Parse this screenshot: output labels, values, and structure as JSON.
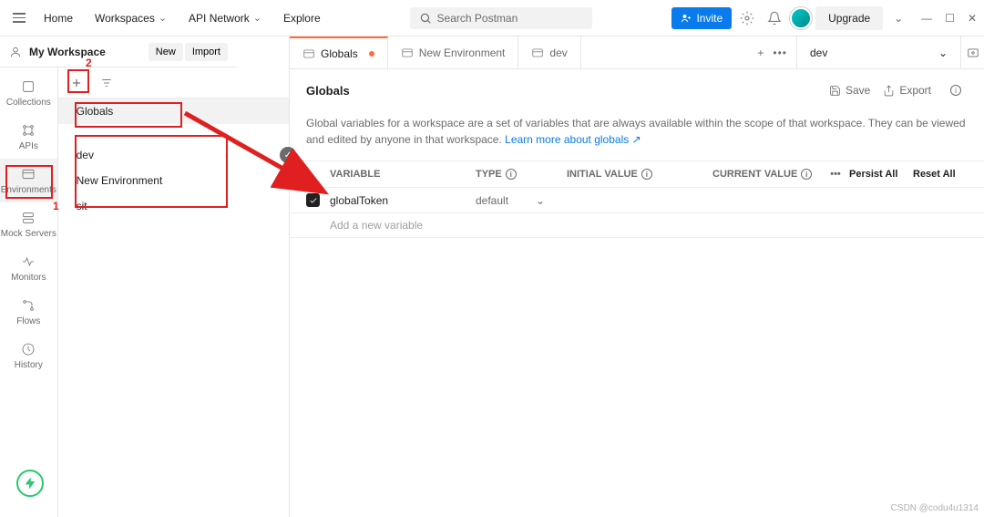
{
  "topnav": {
    "home": "Home",
    "workspaces": "Workspaces",
    "api_network": "API Network",
    "explore": "Explore",
    "search_placeholder": "Search Postman",
    "invite": "Invite",
    "upgrade": "Upgrade"
  },
  "workspace": {
    "title": "My Workspace",
    "new_btn": "New",
    "import_btn": "Import"
  },
  "rail": {
    "collections": "Collections",
    "apis": "APIs",
    "environments": "Environments",
    "mock": "Mock Servers",
    "monitors": "Monitors",
    "flows": "Flows",
    "history": "History"
  },
  "envs": {
    "globals": "Globals",
    "dev": "dev",
    "new_env": "New Environment",
    "sit": "sit"
  },
  "tabs": {
    "globals": "Globals",
    "new_env": "New Environment",
    "dev": "dev",
    "env_selector": "dev"
  },
  "page": {
    "title": "Globals",
    "save": "Save",
    "export": "Export",
    "desc_text": "Global variables for a workspace are a set of variables that are always available within the scope of that workspace. They can be viewed and edited by anyone in that workspace. ",
    "learn_more": "Learn more about globals ↗"
  },
  "table": {
    "variable": "VARIABLE",
    "type": "TYPE",
    "initial": "INITIAL VALUE",
    "current": "CURRENT VALUE",
    "more": "•••",
    "persist": "Persist All",
    "reset": "Reset All",
    "row1_var": "globalToken",
    "row1_type": "default",
    "placeholder": "Add a new variable"
  },
  "annotations": {
    "num1": "1",
    "num2": "2"
  },
  "watermark": "CSDN @codu4u1314"
}
